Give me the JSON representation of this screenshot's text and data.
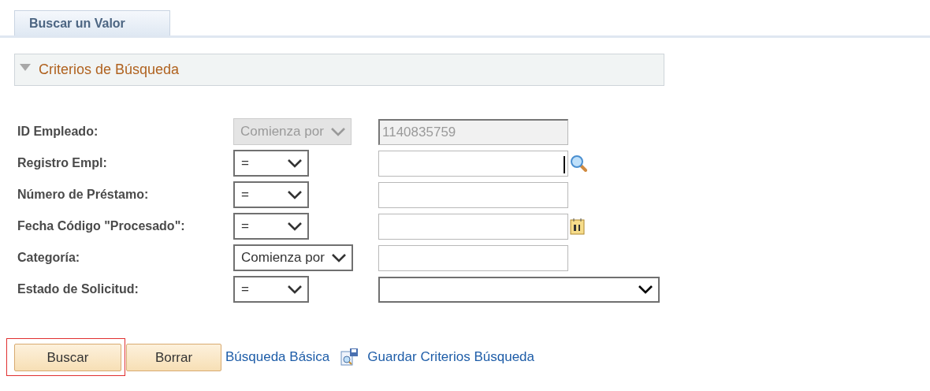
{
  "tabs": [
    {
      "label": "Buscar un Valor",
      "selected": true
    }
  ],
  "section": {
    "title": "Criterios de Búsqueda",
    "expanded": true
  },
  "fields": [
    {
      "label": "ID Empleado:",
      "operator": "Comienza por",
      "disabled": true,
      "kind": "text",
      "value": "1140835759",
      "focused": false
    },
    {
      "label": "Registro Empl:",
      "operator": "=",
      "disabled": false,
      "kind": "lookup",
      "focused": true
    },
    {
      "label": "Número de Préstamo:",
      "operator": "=",
      "disabled": false,
      "kind": "text",
      "focused": false
    },
    {
      "label": "Fecha Código \"Procesado\":",
      "operator": "=",
      "disabled": false,
      "kind": "date",
      "focused": false
    },
    {
      "label": "Categoría:",
      "operator": "Comienza por",
      "disabled": false,
      "kind": "text",
      "focused": false
    },
    {
      "label": "Estado de Solicitud:",
      "operator": "=",
      "disabled": false,
      "kind": "dropdown",
      "focused": false
    }
  ],
  "buttons": [
    {
      "label": "Buscar",
      "focused": true
    },
    {
      "label": "Borrar",
      "focused": false
    }
  ],
  "links": [
    {
      "label": "Búsqueda Básica",
      "kind": "plain"
    },
    {
      "label": "Guardar Criterios Búsqueda",
      "kind": "save"
    }
  ]
}
